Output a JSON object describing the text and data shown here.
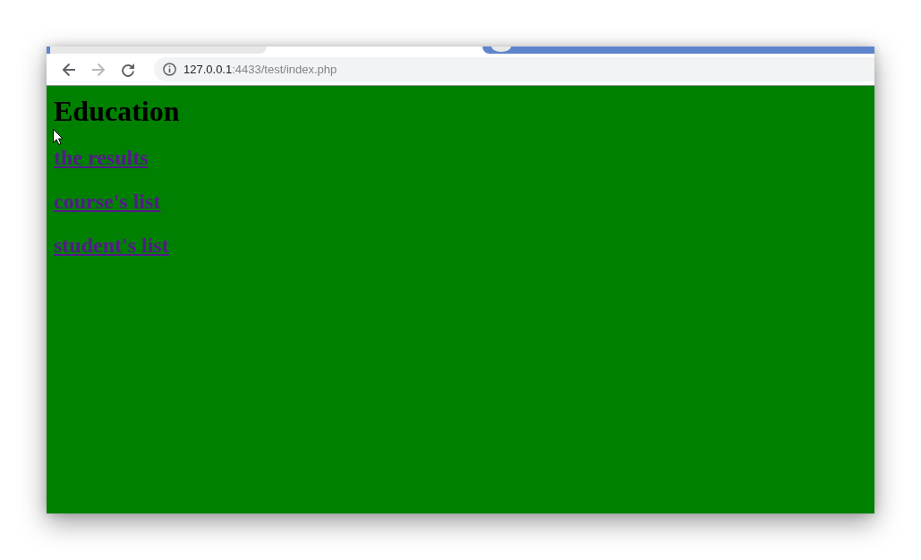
{
  "toolbar": {
    "buttons": [
      {
        "kind": "back",
        "disabled": false
      },
      {
        "kind": "forward",
        "disabled": true
      },
      {
        "kind": "reload",
        "disabled": false
      }
    ],
    "address_bar": {
      "host": "127.0.0.1",
      "path": ":4433/test/index.php"
    }
  },
  "page": {
    "heading": "Education",
    "links": [
      {
        "label": "the results",
        "visited": true
      },
      {
        "label": "course's list",
        "visited": true
      },
      {
        "label": "student's list",
        "visited": true
      }
    ]
  }
}
